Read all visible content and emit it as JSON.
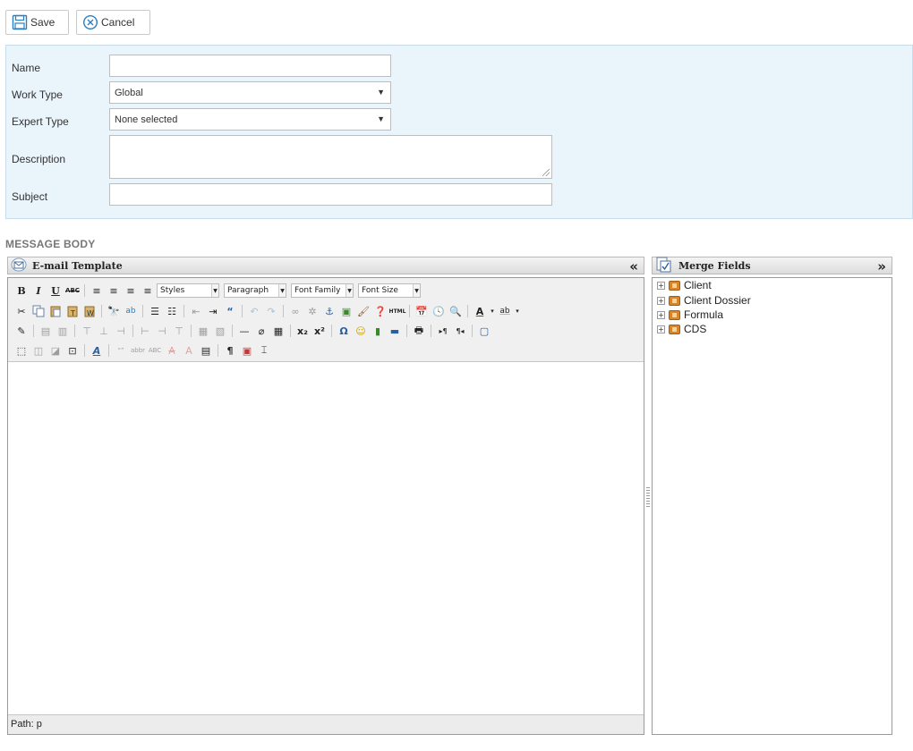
{
  "actions": {
    "save_label": "Save",
    "cancel_label": "Cancel"
  },
  "form": {
    "name_label": "Name",
    "name_value": "",
    "work_type_label": "Work Type",
    "work_type_value": "Global",
    "expert_type_label": "Expert Type",
    "expert_type_value": "None selected",
    "description_label": "Description",
    "description_value": "",
    "subject_label": "Subject",
    "subject_value": ""
  },
  "message_body": {
    "section_title": "MESSAGE BODY",
    "editor_title": "E-mail Template",
    "styles_select": "Styles",
    "format_select": "Paragraph",
    "font_family_select": "Font Family",
    "font_size_select": "Font Size",
    "path_label": "Path: p"
  },
  "merge_fields": {
    "title": "Merge Fields",
    "items": [
      {
        "label": "Client"
      },
      {
        "label": "Client Dossier"
      },
      {
        "label": "Formula"
      },
      {
        "label": "CDS"
      }
    ]
  },
  "icons": {
    "save": "floppy-disk-icon",
    "cancel": "circle-x-icon",
    "envelope": "envelope-icon",
    "merge": "document-check-icon"
  },
  "colors": {
    "form_background": "#eaf4fb",
    "accent_blue": "#2a7fc1",
    "folder_orange": "#d9862b"
  }
}
